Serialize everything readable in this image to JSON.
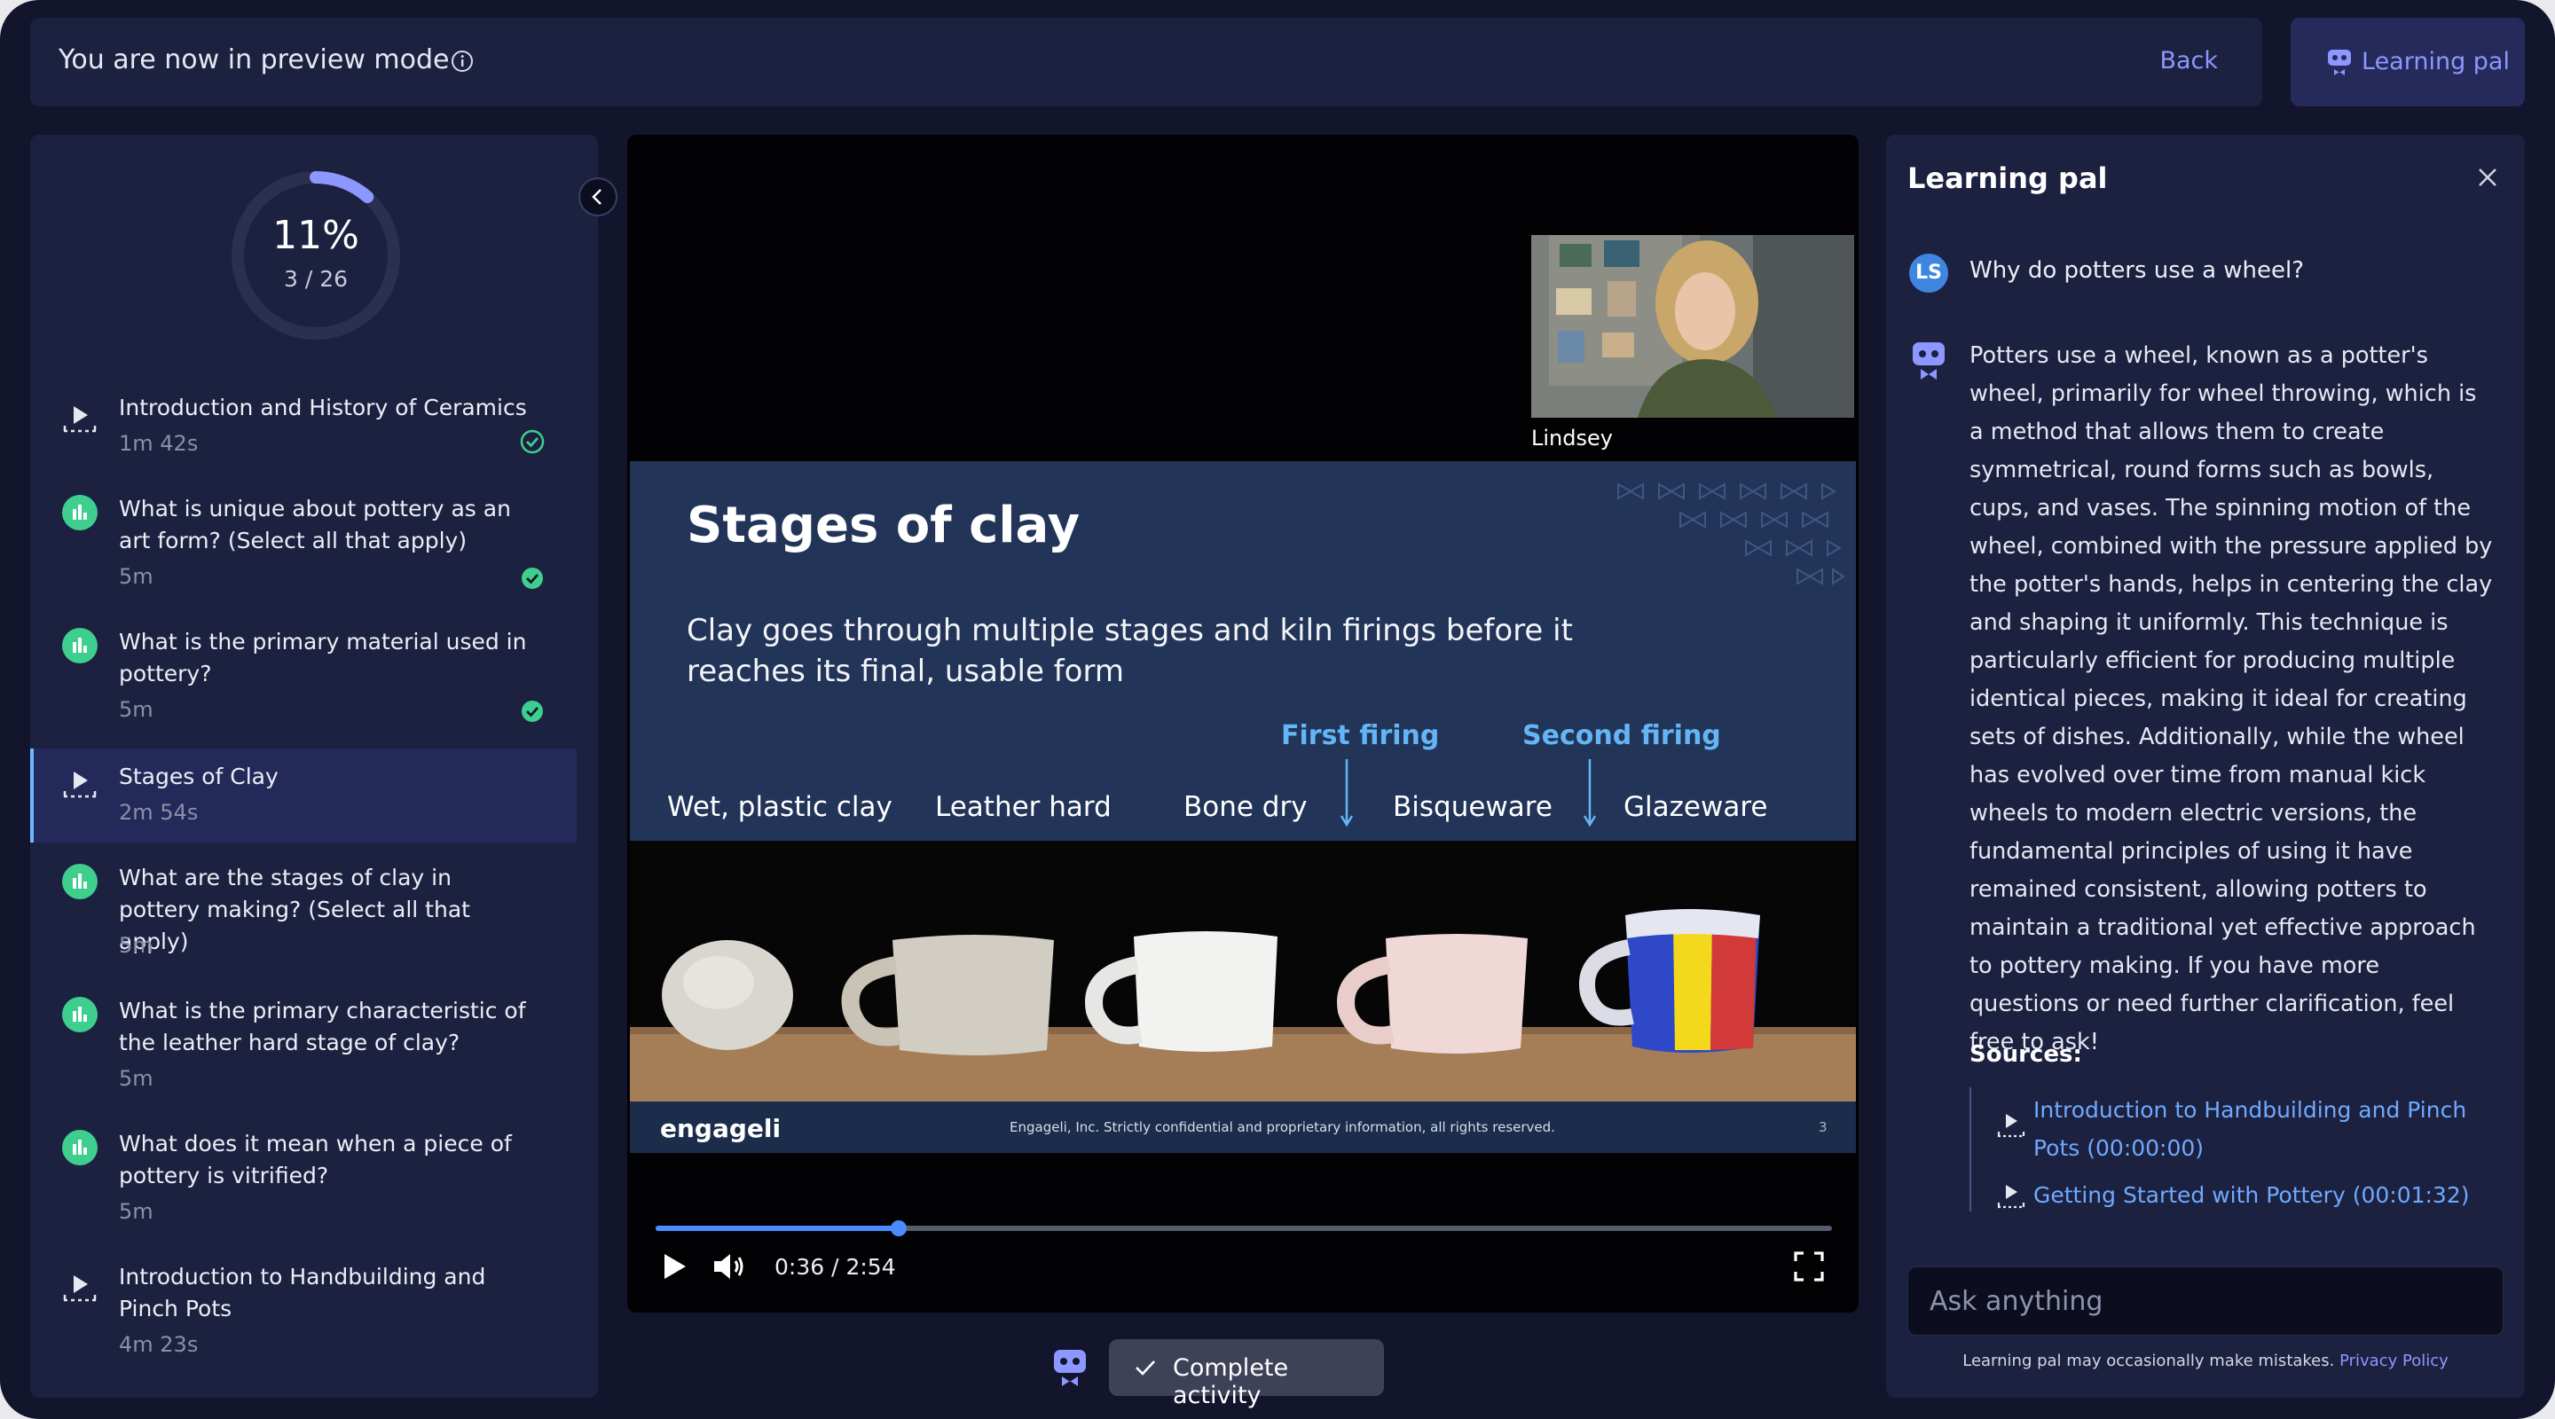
{
  "topbar": {
    "title": "You are now in preview mode",
    "back_label": "Back",
    "learning_pal_label": "Learning pal"
  },
  "progress": {
    "percent_label": "11%",
    "count_label": "3 / 26",
    "fraction": 0.115
  },
  "activities": [
    {
      "title": "Introduction and History of Ceramics",
      "duration": "1m 42s",
      "kind": "video",
      "completed": true
    },
    {
      "title": "What is unique about pottery as an art form? (Select all that apply)",
      "duration": "5m",
      "kind": "poll",
      "completed": true
    },
    {
      "title": "What is the primary material used in pottery?",
      "duration": "5m",
      "kind": "poll",
      "completed": true
    },
    {
      "title": "Stages of Clay",
      "duration": "2m 54s",
      "kind": "video",
      "completed": false,
      "active": true
    },
    {
      "title": "What are the stages of clay in pottery making? (Select all that apply)",
      "duration": "5m",
      "kind": "poll",
      "completed": false
    },
    {
      "title": "What is the primary characteristic of the leather hard stage of clay?",
      "duration": "5m",
      "kind": "poll",
      "completed": false
    },
    {
      "title": "What does it mean when a piece of pottery is vitrified?",
      "duration": "5m",
      "kind": "poll",
      "completed": false
    },
    {
      "title": "Introduction to Handbuilding and Pinch Pots",
      "duration": "4m 23s",
      "kind": "video",
      "completed": false
    }
  ],
  "video": {
    "presenter_name": "Lindsey",
    "slide_title": "Stages of clay",
    "slide_text": "Clay goes through multiple stages and kiln firings before it reaches its final, usable form",
    "first_firing": "First firing",
    "second_firing": "Second firing",
    "stages": [
      "Wet, plastic clay",
      "Leather hard",
      "Bone dry",
      "Bisqueware",
      "Glazeware"
    ],
    "footer_logo": "engageli",
    "footer_text": "Engageli, Inc. Strictly confidential and proprietary information, all rights reserved.",
    "page_number": "3",
    "time_label": "0:36 / 2:54",
    "progress_fraction": 0.207
  },
  "complete_label": "Complete activity",
  "learning_pal": {
    "header": "Learning pal",
    "user_initials": "LS",
    "question": "Why do potters use a wheel?",
    "answer": "Potters use a wheel, known as a potter's wheel, primarily for wheel throwing, which is a method that allows them to create symmetrical, round forms such as bowls, cups, and vases. The spinning motion of the wheel, combined with the pressure applied by the potter's hands, helps in centering the clay and shaping it uniformly. This technique is particularly efficient for producing multiple identical pieces, making it ideal for creating sets of dishes. Additionally, while the wheel has evolved over time from manual kick wheels to modern electric versions, the fundamental principles of using it have remained consistent, allowing potters to maintain a traditional yet effective approach to pottery making. If you have more questions or need further clarification, feel free to ask!",
    "sources_label": "Sources:",
    "sources": [
      "Introduction to Handbuilding and Pinch Pots (00:00:00)",
      "Getting Started with Pottery (00:01:32)"
    ],
    "ask_placeholder": "Ask anything",
    "disclaimer": "Learning pal may occasionally make mistakes.",
    "privacy_label": "Privacy Policy"
  },
  "colors": {
    "accent": "#8c97ff",
    "success": "#3ecf8e",
    "link": "#6fa9ff",
    "panel": "#1d2140",
    "background": "#13152c"
  }
}
